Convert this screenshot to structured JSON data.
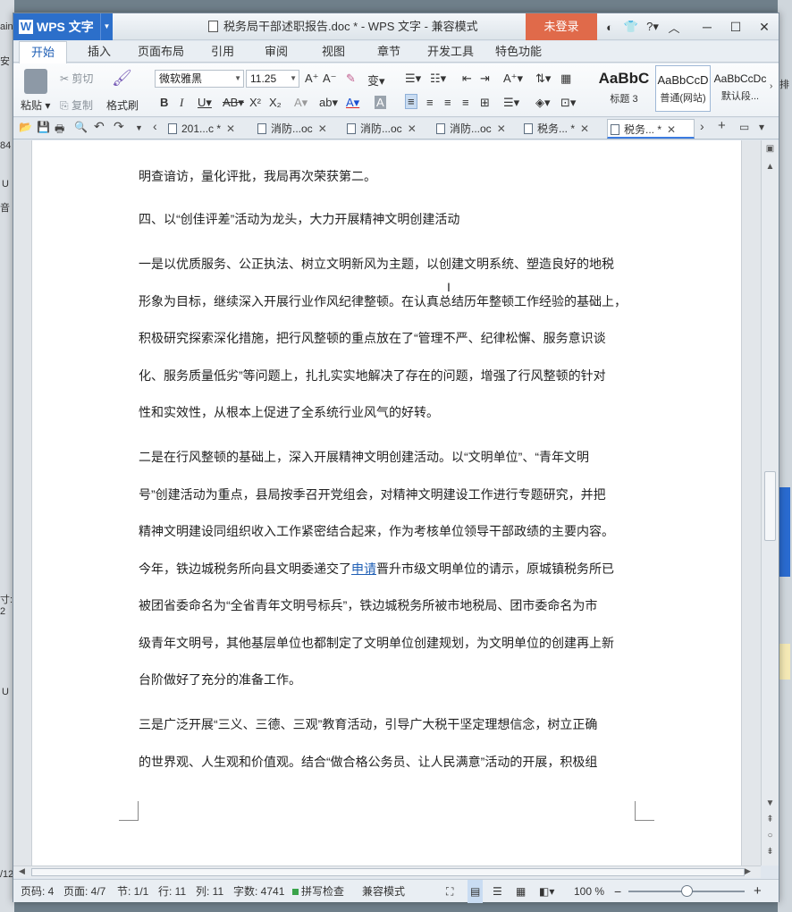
{
  "background": {
    "left_fragments": [
      "ain",
      "安",
      "84",
      "U",
      "音",
      "寸: 2",
      "U",
      "/12"
    ],
    "right_fragments": [
      "排"
    ]
  },
  "titlebar": {
    "app_name": "WPS 文字",
    "doc_title": "税务局干部述职报告.doc * - WPS 文字 - 兼容模式",
    "login": "未登录",
    "icons": [
      "skin-icon",
      "shirt-icon",
      "help-icon",
      "collapse-icon"
    ],
    "help_label": "?"
  },
  "menu": {
    "tabs": [
      "开始",
      "插入",
      "页面布局",
      "引用",
      "审阅",
      "视图",
      "章节",
      "开发工具",
      "特色功能"
    ]
  },
  "ribbon": {
    "paste": "粘贴",
    "cut": "剪切",
    "copy": "复制",
    "format_painter": "格式刷",
    "font_name": "微软雅黑",
    "font_size": "11.25",
    "styles": [
      {
        "sample": "AaBbC",
        "name": "标题 3"
      },
      {
        "sample": "AaBbCcD",
        "name": "普通(网站)"
      },
      {
        "sample": "AaBbCcDc",
        "name": "默认段..."
      }
    ]
  },
  "doc_tabs": [
    {
      "label": "201...c *",
      "active": false
    },
    {
      "label": "消防...oc",
      "active": false
    },
    {
      "label": "消防...oc",
      "active": false
    },
    {
      "label": "消防...oc",
      "active": false
    },
    {
      "label": "税务... *",
      "active": false
    },
    {
      "label": "税务... *",
      "active": true
    }
  ],
  "document": {
    "lines": [
      "明查谙访，量化评批，我局再次荣获第二。",
      "四、以“创佳评差”活动为龙头，大力开展精神文明创建活动",
      "一是以优质服务、公正执法、树立文明新风为主题，以创建文明系统、塑造良好的地税",
      "形象为目标，继续深入开展行业作风纪律整顿。在认真总结历年整顿工作经验的基础上，",
      "积极研究探索深化措施，把行风整顿的重点放在了“管理不严、纪律松懈、服务意识谈",
      "化、服务质量低劣”等问题上，扎扎实实地解决了存在的问题，增强了行风整顿的针对",
      "性和实效性，从根本上促进了全系统行业风气的好转。",
      "二是在行风整顿的基础上，深入开展精神文明创建活动。以“文明单位”、“青年文明",
      "号”创建活动为重点，县局按季召开党组会，对精神文明建设工作进行专题研究，并把",
      "精神文明建设同组织收入工作紧密结合起来，作为考核单位领导干部政绩的主要内容。",
      "今年，铁边城税务所向县文明委递交了",
      "申请",
      "晋升市级文明单位的请示，原城镇税务所已",
      "被团省委命名为“全省青年文明号标兵”，铁边城税务所被市地税局、团市委命名为市",
      "级青年文明号，其他基层单位也都制定了文明单位创建规划，为文明单位的创建再上新",
      "台阶做好了充分的准备工作。",
      "三是广泛开展“三义、三德、三观”教育活动，引导广大税干坚定理想信念，树立正确",
      "的世界观、人生观和价值观。结合“做合格公务员、让人民满意”活动的开展，积极组"
    ]
  },
  "statusbar": {
    "page_num": "页码: 4",
    "pages": "页面: 4/7",
    "section": "节: 1/1",
    "row": "行: 11",
    "col": "列: 11",
    "words": "字数: 4741",
    "spellcheck": "拼写检查",
    "compat": "兼容模式",
    "zoom": "100 %",
    "zoom_fraction": 0.5
  }
}
